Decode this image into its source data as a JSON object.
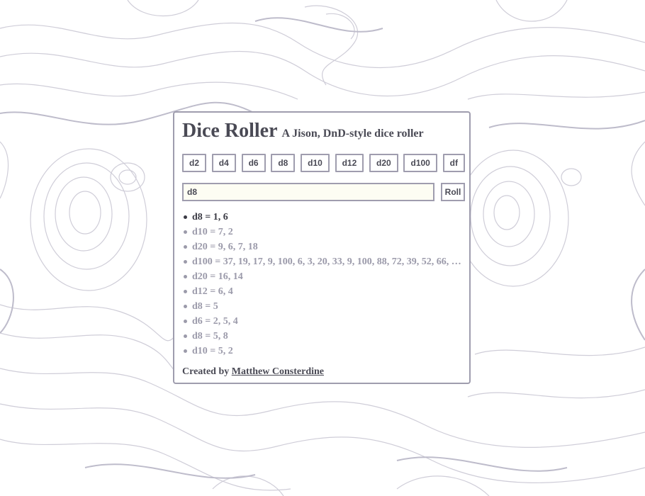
{
  "header": {
    "title": "Dice Roller",
    "subtitle": "A Jison, DnD-style dice roller"
  },
  "dice_buttons": [
    {
      "label": "d2"
    },
    {
      "label": "d4"
    },
    {
      "label": "d6"
    },
    {
      "label": "d8"
    },
    {
      "label": "d10"
    },
    {
      "label": "d12"
    },
    {
      "label": "d20"
    },
    {
      "label": "d100"
    },
    {
      "label": "df"
    }
  ],
  "roll_form": {
    "input_value": "d8",
    "roll_label": "Roll"
  },
  "history": [
    {
      "text": "d8 = 1, 6",
      "latest": true
    },
    {
      "text": "d10 = 7, 2",
      "latest": false
    },
    {
      "text": "d20 = 9, 6, 7, 18",
      "latest": false
    },
    {
      "text": "d100 = 37, 19, 17, 9, 100, 6, 3, 20, 33, 9, 100, 88, 72, 39, 52, 66, …",
      "latest": false
    },
    {
      "text": "d20 = 16, 14",
      "latest": false
    },
    {
      "text": "d12 = 6, 4",
      "latest": false
    },
    {
      "text": "d8 = 5",
      "latest": false
    },
    {
      "text": "d6 = 2, 5, 4",
      "latest": false
    },
    {
      "text": "d8 = 5, 8",
      "latest": false
    },
    {
      "text": "d10 = 5, 2",
      "latest": false
    }
  ],
  "footer": {
    "prefix": "Created by",
    "author_link": "Matthew Consterdine"
  },
  "colors": {
    "border": "#9f9dae",
    "text": "#4a4a55",
    "muted_text": "#9b9aaa",
    "input_bg": "#fdfdf3",
    "contour_lines": "#c9c7d2"
  },
  "background": {
    "pattern": "topographic-contour-lines"
  }
}
